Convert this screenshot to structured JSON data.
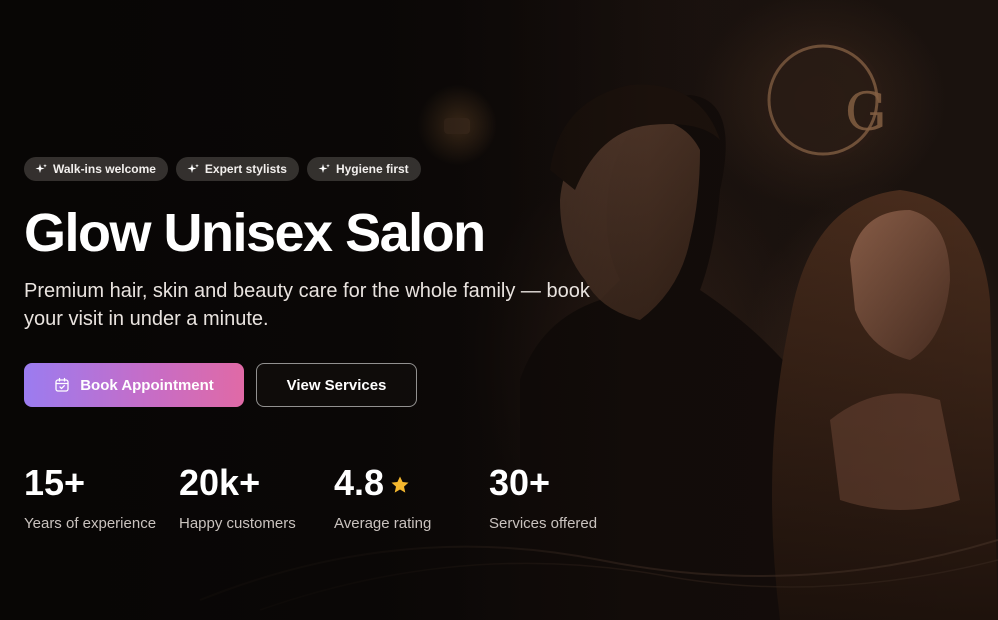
{
  "badges": [
    {
      "label": "Walk-ins welcome",
      "icon": "sparkle-icon"
    },
    {
      "label": "Expert stylists",
      "icon": "sparkle-icon"
    },
    {
      "label": "Hygiene first",
      "icon": "sparkle-icon"
    }
  ],
  "hero": {
    "title": "Glow Unisex Salon",
    "subtitle": "Premium hair, skin and beauty care for the whole family — book your visit in under a minute."
  },
  "actions": {
    "book_label": "Book Appointment",
    "book_icon": "calendar-check-icon",
    "services_label": "View Services"
  },
  "stats": [
    {
      "value": "15+",
      "label": "Years of experience"
    },
    {
      "value": "20k+",
      "label": "Happy customers"
    },
    {
      "value": "4.8",
      "label": "Average rating",
      "icon": "star-icon"
    },
    {
      "value": "30+",
      "label": "Services offered"
    }
  ],
  "colors": {
    "accent_start": "#9b7cf0",
    "accent_end": "#e06aa6",
    "star": "#f5b82e",
    "background": "#0b0807"
  }
}
